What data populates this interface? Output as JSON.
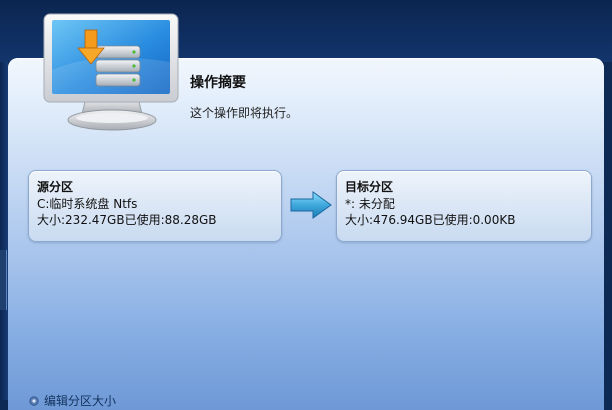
{
  "summary": {
    "title": "操作摘要",
    "description": "这个操作即将执行。"
  },
  "source": {
    "title": "源分区",
    "name_line": "C:临时系统盘 Ntfs",
    "size_line": "大小:232.47GB已使用:88.28GB"
  },
  "target": {
    "title": "目标分区",
    "name_line": "*: 未分配",
    "size_line": "大小:476.94GB已使用:0.00KB"
  },
  "footer": {
    "link_label": "编辑分区大小"
  },
  "icons": {
    "monitor": "drive-copy-monitor-icon",
    "arrow": "right-arrow-icon",
    "gear": "gear-icon"
  },
  "colors": {
    "panel_top": "#f2f7fd",
    "panel_bottom": "#6e99d6",
    "arrow_fill": "#3fa8dc",
    "box_border": "#8ea9cf"
  }
}
